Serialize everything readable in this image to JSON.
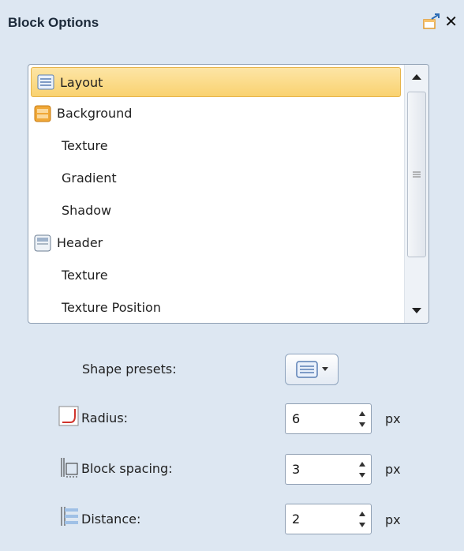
{
  "panel": {
    "title": "Block Options",
    "close_label": "✕"
  },
  "list": {
    "items": [
      {
        "label": "Layout",
        "icon": "layout-icon",
        "selected": true
      },
      {
        "label": "Background",
        "icon": "background-icon"
      },
      {
        "label": "Texture"
      },
      {
        "label": "Gradient"
      },
      {
        "label": "Shadow"
      },
      {
        "label": "Header",
        "icon": "header-icon"
      },
      {
        "label": "Texture"
      },
      {
        "label": "Texture Position"
      }
    ]
  },
  "options": {
    "shape_presets_label": "Shape presets:",
    "radius": {
      "label": "Radius:",
      "value": "6",
      "unit": "px"
    },
    "block_spacing": {
      "label": "Block spacing:",
      "value": "3",
      "unit": "px"
    },
    "distance": {
      "label": "Distance:",
      "value": "2",
      "unit": "px"
    }
  },
  "colors": {
    "panel_bg": "#dde7f2",
    "selection": "#f9d270",
    "accent_orange": "#f0a838"
  }
}
